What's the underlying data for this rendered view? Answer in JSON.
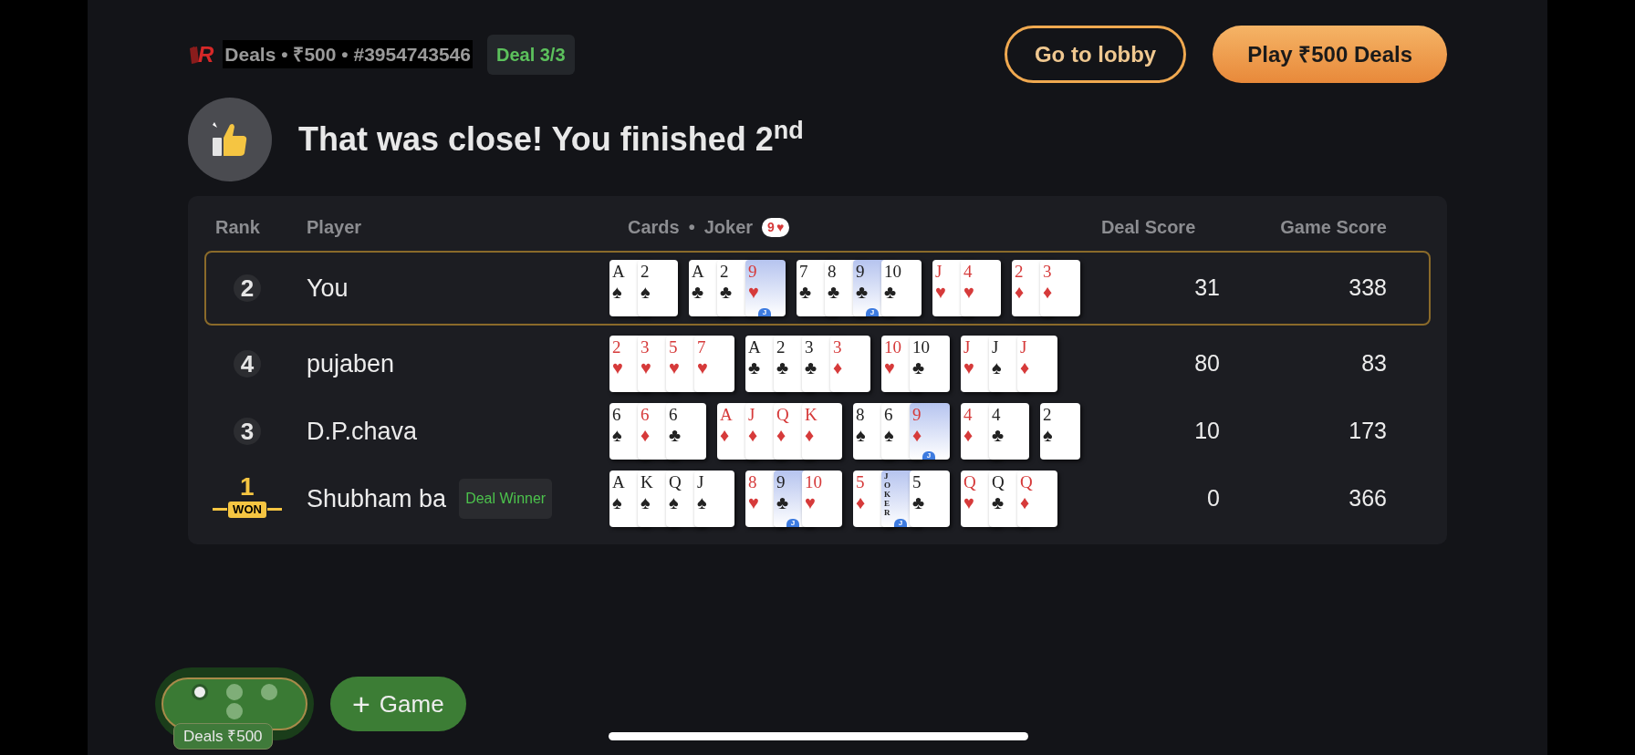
{
  "header": {
    "logo": "R",
    "meta": "Deals • ₹500 • #3954743546",
    "badge": "Deal 3/3",
    "buttons": [
      {
        "kind": "outline",
        "label": "Go to lobby"
      },
      {
        "kind": "primary",
        "label": "Play ₹500 Deals"
      }
    ]
  },
  "result": {
    "title": "That was close! You finished 2$^{nd}$"
  },
  "table": {
    "columns": [
      "Rank",
      "Player",
      "Cards",
      "Joker",
      "Deal Score",
      "Game Score"
    ],
    "separator": "•",
    "joker": {
      "rank": "9",
      "suit": "♥",
      "color": "#d63a3a"
    },
    "rows": [
      {
        "selected": true,
        "rank": {
          "kind": "number",
          "text": "2"
        },
        "player": "You",
        "groups": [
          [
            {
              "rank": "A",
              "suit": "♠",
              "color": "#222222"
            },
            {
              "rank": "2",
              "suit": "♠",
              "color": "#222222"
            }
          ],
          [
            {
              "rank": "A",
              "suit": "♣",
              "color": "#222222"
            },
            {
              "rank": "2",
              "suit": "♣",
              "color": "#222222"
            },
            {
              "rank": "9",
              "suit": "♥",
              "color": "#d63a3a",
              "kind": "joker",
              "tag": "J"
            }
          ],
          [
            {
              "rank": "7",
              "suit": "♣",
              "color": "#222222"
            },
            {
              "rank": "8",
              "suit": "♣",
              "color": "#222222"
            },
            {
              "rank": "9",
              "suit": "♣",
              "color": "#222222",
              "kind": "joker",
              "tag": "J"
            },
            {
              "rank": "10",
              "suit": "♣",
              "color": "#222222"
            }
          ],
          [
            {
              "rank": "J",
              "suit": "♥",
              "color": "#d63a3a"
            },
            {
              "rank": "4",
              "suit": "♥",
              "color": "#d63a3a"
            }
          ],
          [
            {
              "rank": "2",
              "suit": "♦",
              "color": "#d63a3a"
            },
            {
              "rank": "3",
              "suit": "♦",
              "color": "#d63a3a"
            }
          ]
        ],
        "deal_score": "31",
        "game_score": "338"
      },
      {
        "selected": false,
        "rank": {
          "kind": "number",
          "text": "4"
        },
        "player": "pujaben",
        "groups": [
          [
            {
              "rank": "2",
              "suit": "♥",
              "color": "#d63a3a"
            },
            {
              "rank": "3",
              "suit": "♥",
              "color": "#d63a3a"
            },
            {
              "rank": "5",
              "suit": "♥",
              "color": "#d63a3a"
            },
            {
              "rank": "7",
              "suit": "♥",
              "color": "#d63a3a"
            }
          ],
          [
            {
              "rank": "A",
              "suit": "♣",
              "color": "#222222"
            },
            {
              "rank": "2",
              "suit": "♣",
              "color": "#222222"
            },
            {
              "rank": "3",
              "suit": "♣",
              "color": "#222222"
            },
            {
              "rank": "3",
              "suit": "♦",
              "color": "#d63a3a"
            }
          ],
          [
            {
              "rank": "10",
              "suit": "♥",
              "color": "#d63a3a"
            },
            {
              "rank": "10",
              "suit": "♣",
              "color": "#222222"
            }
          ],
          [
            {
              "rank": "J",
              "suit": "♥",
              "color": "#d63a3a"
            },
            {
              "rank": "J",
              "suit": "♠",
              "color": "#222222"
            },
            {
              "rank": "J",
              "suit": "♦",
              "color": "#d63a3a"
            }
          ]
        ],
        "deal_score": "80",
        "game_score": "83"
      },
      {
        "selected": false,
        "rank": {
          "kind": "number",
          "text": "3"
        },
        "player": "D.P.chava",
        "groups": [
          [
            {
              "rank": "6",
              "suit": "♠",
              "color": "#222222"
            },
            {
              "rank": "6",
              "suit": "♦",
              "color": "#d63a3a"
            },
            {
              "rank": "6",
              "suit": "♣",
              "color": "#222222"
            }
          ],
          [
            {
              "rank": "A",
              "suit": "♦",
              "color": "#d63a3a"
            },
            {
              "rank": "J",
              "suit": "♦",
              "color": "#d63a3a"
            },
            {
              "rank": "Q",
              "suit": "♦",
              "color": "#d63a3a"
            },
            {
              "rank": "K",
              "suit": "♦",
              "color": "#d63a3a"
            }
          ],
          [
            {
              "rank": "8",
              "suit": "♠",
              "color": "#222222"
            },
            {
              "rank": "6",
              "suit": "♠",
              "color": "#222222"
            },
            {
              "rank": "9",
              "suit": "♦",
              "color": "#d63a3a",
              "kind": "joker",
              "tag": "J"
            }
          ],
          [
            {
              "rank": "4",
              "suit": "♦",
              "color": "#d63a3a"
            },
            {
              "rank": "4",
              "suit": "♣",
              "color": "#222222"
            }
          ],
          [
            {
              "rank": "2",
              "suit": "♠",
              "color": "#222222"
            }
          ]
        ],
        "deal_score": "10",
        "game_score": "173"
      },
      {
        "selected": false,
        "rank": {
          "kind": "won",
          "text": "1",
          "label": "WON"
        },
        "player": "Shubham ba",
        "badge": "Deal Winner",
        "groups": [
          [
            {
              "rank": "A",
              "suit": "♠",
              "color": "#222222"
            },
            {
              "rank": "K",
              "suit": "♠",
              "color": "#222222"
            },
            {
              "rank": "Q",
              "suit": "♠",
              "color": "#222222"
            },
            {
              "rank": "J",
              "suit": "♠",
              "color": "#222222"
            }
          ],
          [
            {
              "rank": "8",
              "suit": "♥",
              "color": "#d63a3a"
            },
            {
              "rank": "9",
              "suit": "♣",
              "color": "#222222",
              "kind": "joker",
              "tag": "J"
            },
            {
              "rank": "10",
              "suit": "♥",
              "color": "#d63a3a"
            }
          ],
          [
            {
              "rank": "5",
              "suit": "♦",
              "color": "#d63a3a"
            },
            {
              "rank": "JOKER",
              "kind": "printed_joker",
              "tag": "J",
              "color": "#222222"
            },
            {
              "rank": "5",
              "suit": "♣",
              "color": "#222222"
            }
          ],
          [
            {
              "rank": "Q",
              "suit": "♥",
              "color": "#d63a3a"
            },
            {
              "rank": "Q",
              "suit": "♣",
              "color": "#222222"
            },
            {
              "rank": "Q",
              "suit": "♦",
              "color": "#d63a3a"
            }
          ]
        ],
        "deal_score": "0",
        "game_score": "366"
      }
    ]
  },
  "table_switcher": {
    "dots": [
      {
        "selected": true
      },
      {
        "selected": false
      },
      {
        "selected": false
      },
      {
        "selected": false
      }
    ],
    "label": "Deals ₹500"
  },
  "new_game_button": {
    "icon": "+",
    "label": "Game"
  }
}
